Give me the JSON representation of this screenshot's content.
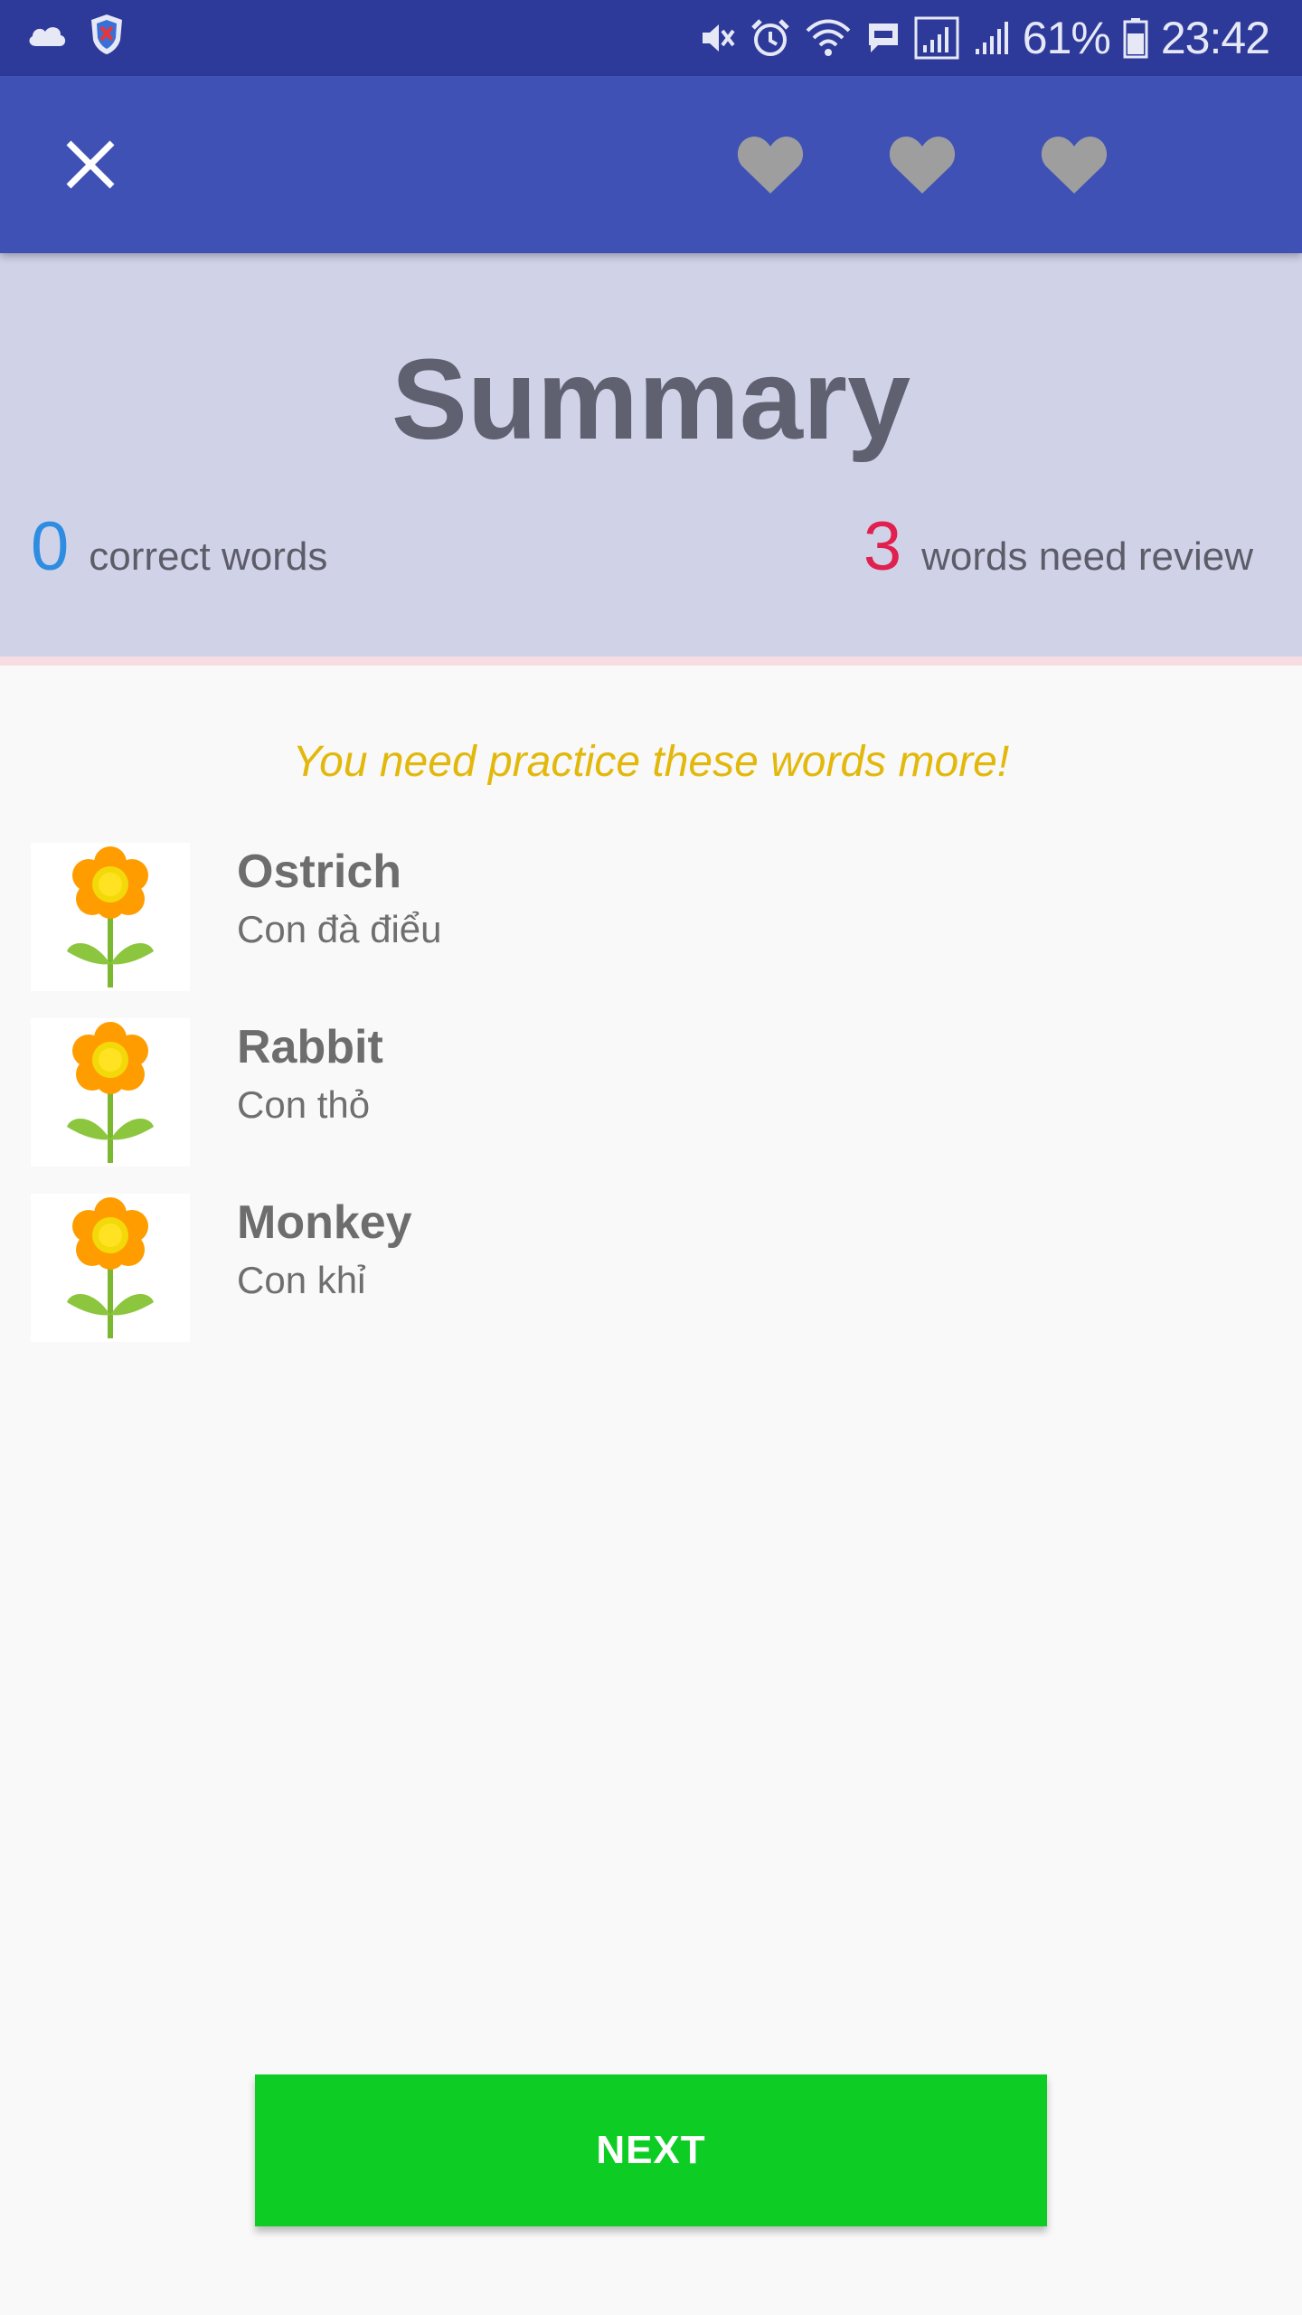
{
  "status_bar": {
    "battery": "61%",
    "time": "23:42",
    "icons": [
      "cloud-icon",
      "shield-icon",
      "mute-icon",
      "alarm-icon",
      "wifi-icon",
      "message-icon",
      "signal-icon",
      "signal-icon",
      "battery-icon"
    ]
  },
  "app_bar": {
    "close_icon": "close-icon",
    "hearts": [
      "heart-icon",
      "heart-icon",
      "heart-icon"
    ],
    "heart_color": "#9e9e9e",
    "color": "#3f51b5"
  },
  "summary": {
    "title": "Summary",
    "correct_count": "0",
    "correct_label": "correct words",
    "review_count": "3",
    "review_label": "words need review"
  },
  "practice_message": "You need practice these words more!",
  "words": [
    {
      "word": "Ostrich",
      "translation": "Con đà điểu",
      "icon": "flower-icon"
    },
    {
      "word": "Rabbit",
      "translation": "Con thỏ",
      "icon": "flower-icon"
    },
    {
      "word": "Monkey",
      "translation": "Con khỉ",
      "icon": "flower-icon"
    }
  ],
  "next_button": {
    "label": "NEXT",
    "color": "#0dcd25"
  }
}
